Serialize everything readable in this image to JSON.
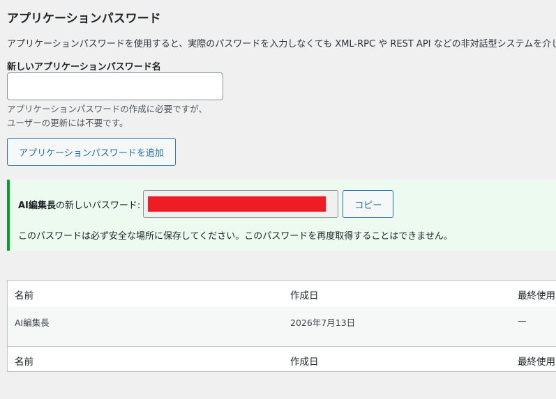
{
  "section": {
    "title": "アプリケーションパスワード",
    "description": "アプリケーションパスワードを使用すると、実際のパスワードを入力しなくても XML-RPC や REST API などの非対話型システムを介した"
  },
  "form": {
    "label": "新しいアプリケーションパスワード名",
    "input_value": "",
    "input_placeholder": "",
    "help_line1": "アプリケーションパスワードの作成に必要ですが、",
    "help_line2": "ユーザーの更新には不要です。",
    "add_button": "アプリケーションパスワードを追加"
  },
  "notice": {
    "user": "AI編集長",
    "label_suffix": " の新しいパスワード:",
    "copy_button": "コピー",
    "warning": "このパスワードは必ず安全な場所に保存してください。このパスワードを再度取得することはできません。"
  },
  "table": {
    "columns": [
      "名前",
      "作成日",
      "最終使用"
    ],
    "rows": [
      [
        "AI編集長",
        "2026年7月13日",
        "—"
      ]
    ],
    "footer": [
      "名前",
      "作成日",
      "最終使用"
    ]
  },
  "colors": {
    "accent": "#2271b1",
    "success": "#00a32a",
    "redaction": "#ee1c25"
  }
}
